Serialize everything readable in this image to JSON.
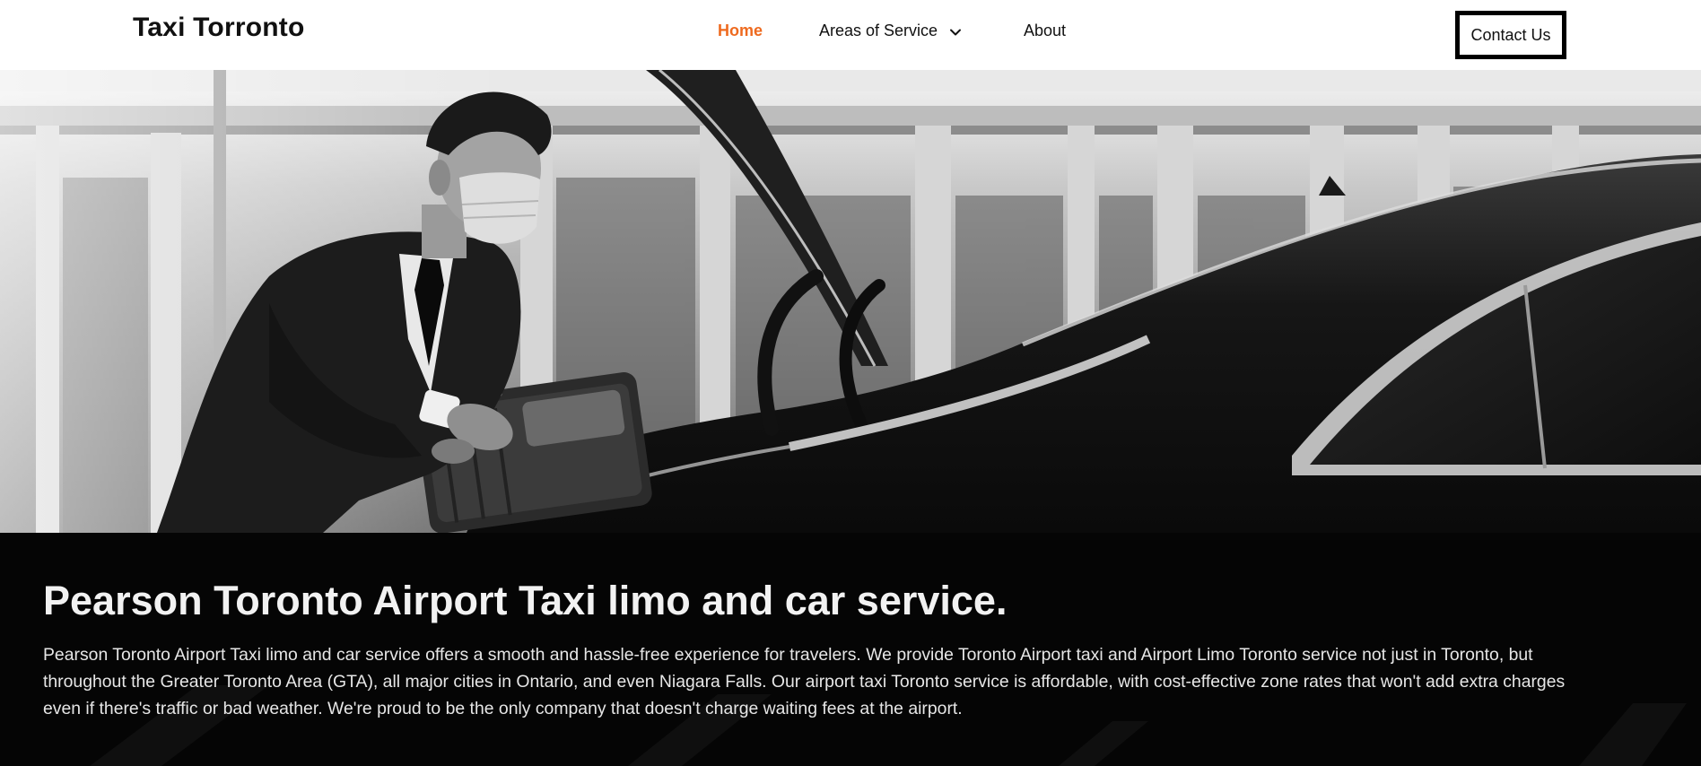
{
  "header": {
    "logo": "Taxi Torronto",
    "nav": {
      "home": "Home",
      "areas": "Areas of Service",
      "about": "About"
    },
    "contact_button": "Contact Us",
    "accent_color": "#ee6a1f"
  },
  "hero": {
    "image": "black-and-white photo of masked driver in suit loading a suitcase into the trunk of a black car at an airport"
  },
  "content": {
    "title": "Pearson Toronto Airport Taxi limo and car service.",
    "body": "Pearson Toronto Airport Taxi limo and car service offers a smooth and hassle-free experience for travelers. We provide Toronto Airport taxi and Airport Limo Toronto service not just in Toronto, but throughout the Greater Toronto Area (GTA), all major cities in Ontario, and even Niagara Falls. Our airport taxi Toronto service is affordable, with cost-effective zone rates that won't add extra charges even if there's traffic or bad weather. We're proud to be the only company that doesn't charge waiting fees at the airport."
  },
  "icons": {
    "dropdown": "chevron-down-icon"
  }
}
